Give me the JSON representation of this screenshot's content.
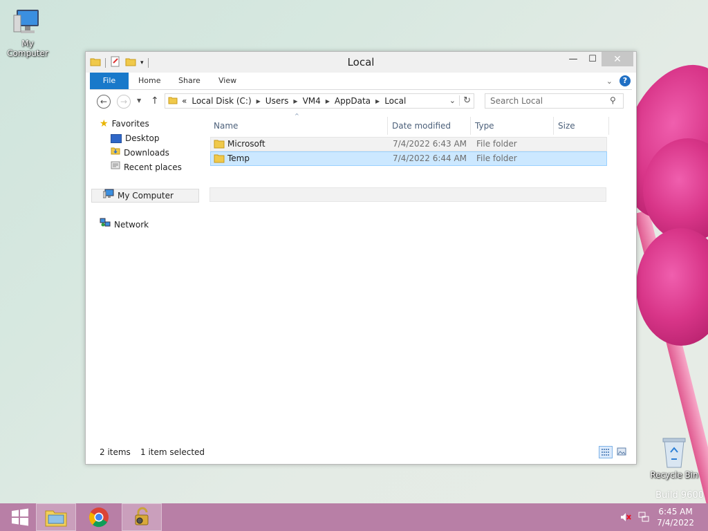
{
  "desktop": {
    "icons": [
      {
        "label": "My Computer"
      },
      {
        "label": "Recycle Bin"
      }
    ],
    "build_text": "Build 9600"
  },
  "window": {
    "title": "Local",
    "controls": {
      "minimize": "—",
      "maximize": "☐",
      "close": "✕"
    },
    "ribbon": {
      "tabs": [
        "File",
        "Home",
        "Share",
        "View"
      ],
      "help": "?"
    },
    "nav": {
      "breadcrumb": [
        "Local Disk (C:)",
        "Users",
        "VM4",
        "AppData",
        "Local"
      ],
      "overflow": "«",
      "search_placeholder": "Search Local"
    },
    "navpane": {
      "favorites": "Favorites",
      "desktop": "Desktop",
      "downloads": "Downloads",
      "recent": "Recent places",
      "computer": "My Computer",
      "network": "Network"
    },
    "columns": {
      "name": "Name",
      "date": "Date modified",
      "type": "Type",
      "size": "Size"
    },
    "files": [
      {
        "name": "Microsoft",
        "date": "7/4/2022 6:43 AM",
        "type": "File folder",
        "size": ""
      },
      {
        "name": "Temp",
        "date": "7/4/2022 6:44 AM",
        "type": "File folder",
        "size": ""
      }
    ],
    "status": {
      "count": "2 items",
      "selection": "1 item selected"
    }
  },
  "taskbar": {
    "time": "6:45 AM",
    "date": "7/4/2022"
  },
  "colors": {
    "accent": "#1979ca",
    "selection_bg": "#cce8ff",
    "selection_border": "#99d1ff",
    "taskbar": "#b87fa6"
  }
}
